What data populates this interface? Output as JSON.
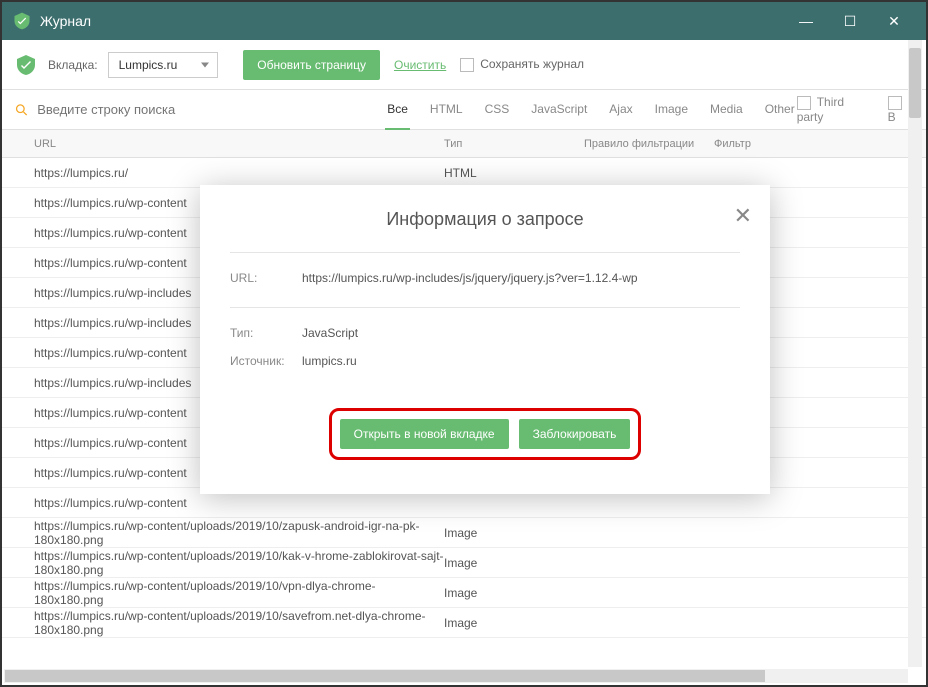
{
  "window": {
    "title": "Журнал"
  },
  "toolbar": {
    "tab_label": "Вкладка:",
    "dropdown_value": "Lumpics.ru",
    "refresh": "Обновить страницу",
    "clear": "Очистить",
    "save_log": "Сохранять журнал"
  },
  "search": {
    "placeholder": "Введите строку поиска"
  },
  "filters": {
    "tabs": [
      "Все",
      "HTML",
      "CSS",
      "JavaScript",
      "Ajax",
      "Image",
      "Media",
      "Other"
    ],
    "third_party": "Third party",
    "blocked_short": "B"
  },
  "columns": {
    "url": "URL",
    "type": "Тип",
    "rule": "Правило фильтрации",
    "filter": "Фильтр"
  },
  "rows": [
    {
      "url": "https://lumpics.ru/",
      "type": "HTML"
    },
    {
      "url": "https://lumpics.ru/wp-content",
      "type": ""
    },
    {
      "url": "https://lumpics.ru/wp-content",
      "type": ""
    },
    {
      "url": "https://lumpics.ru/wp-content",
      "type": ""
    },
    {
      "url": "https://lumpics.ru/wp-includes",
      "type": ""
    },
    {
      "url": "https://lumpics.ru/wp-includes",
      "type": ""
    },
    {
      "url": "https://lumpics.ru/wp-content",
      "type": ""
    },
    {
      "url": "https://lumpics.ru/wp-includes",
      "type": ""
    },
    {
      "url": "https://lumpics.ru/wp-content",
      "type": ""
    },
    {
      "url": "https://lumpics.ru/wp-content",
      "type": ""
    },
    {
      "url": "https://lumpics.ru/wp-content",
      "type": ""
    },
    {
      "url": "https://lumpics.ru/wp-content",
      "type": ""
    },
    {
      "url": "https://lumpics.ru/wp-content/uploads/2019/10/zapusk-android-igr-na-pk-180x180.png",
      "type": "Image"
    },
    {
      "url": "https://lumpics.ru/wp-content/uploads/2019/10/kak-v-hrome-zablokirovat-sajt-180x180.png",
      "type": "Image"
    },
    {
      "url": "https://lumpics.ru/wp-content/uploads/2019/10/vpn-dlya-chrome-180x180.png",
      "type": "Image"
    },
    {
      "url": "https://lumpics.ru/wp-content/uploads/2019/10/savefrom.net-dlya-chrome-180x180.png",
      "type": "Image"
    }
  ],
  "modal": {
    "title": "Информация о запросе",
    "url_label": "URL:",
    "url_value": "https://lumpics.ru/wp-includes/js/jquery/jquery.js?ver=1.12.4-wp",
    "type_label": "Тип:",
    "type_value": "JavaScript",
    "source_label": "Источник:",
    "source_value": "lumpics.ru",
    "open_button": "Открыть в новой вкладке",
    "block_button": "Заблокировать"
  }
}
